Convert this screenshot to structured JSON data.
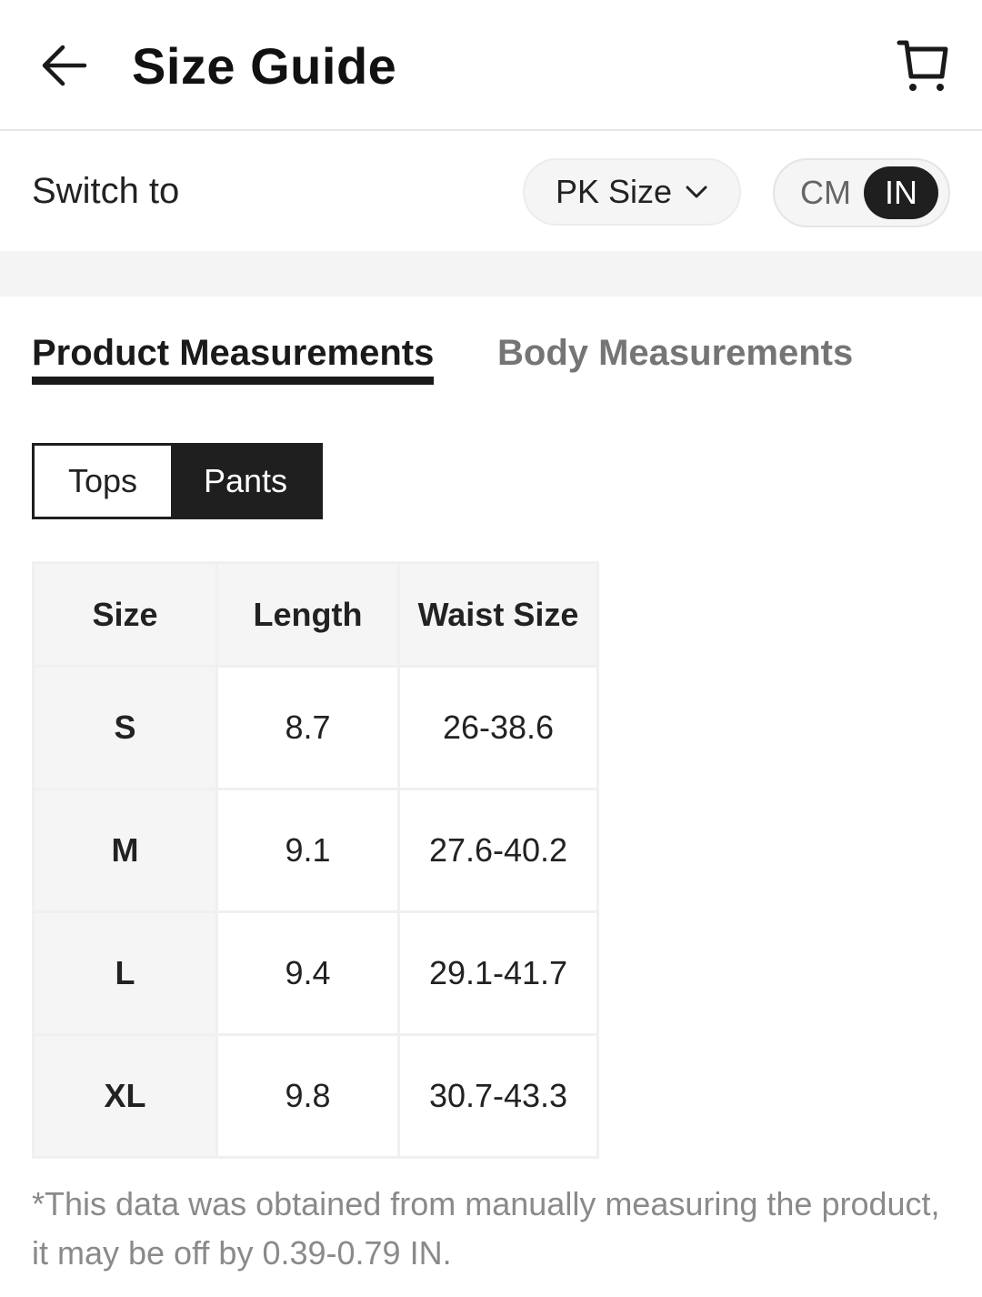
{
  "header": {
    "title": "Size Guide",
    "back_icon": "arrow-left-icon",
    "cart_icon": "cart-icon"
  },
  "switch_row": {
    "label": "Switch to",
    "region_select": {
      "value": "PK Size",
      "icon": "chevron-down-icon"
    },
    "unit_toggle": {
      "options": [
        "CM",
        "IN"
      ],
      "selected": "IN"
    }
  },
  "tabs": [
    {
      "label": "Product Measurements",
      "active": true
    },
    {
      "label": "Body Measurements",
      "active": false
    }
  ],
  "segment": [
    {
      "label": "Tops",
      "active": false
    },
    {
      "label": "Pants",
      "active": true
    }
  ],
  "table": {
    "headers": [
      "Size",
      "Length",
      "Waist Size"
    ],
    "rows": [
      [
        "S",
        "8.7",
        "26-38.6"
      ],
      [
        "M",
        "9.1",
        "27.6-40.2"
      ],
      [
        "L",
        "9.4",
        "29.1-41.7"
      ],
      [
        "XL",
        "9.8",
        "30.7-43.3"
      ]
    ]
  },
  "note": "*This data was obtained from manually measuring the product, it may be off by 0.39-0.79 IN.",
  "colors": {
    "accent": "#1f1f1f",
    "muted_text": "#8a8a8a",
    "band": "#f4f4f4"
  }
}
